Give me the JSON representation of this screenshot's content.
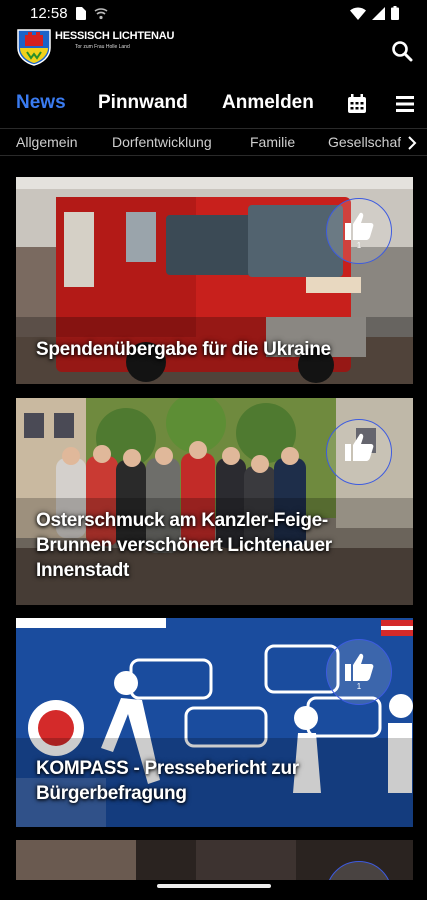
{
  "status": {
    "time": "12:58"
  },
  "header": {
    "title": "HESSISCH LICHTENAU",
    "subtitle": "Tor zum Frau Holle Land"
  },
  "nav": {
    "news": "News",
    "pinnwand": "Pinnwand",
    "anmelden": "Anmelden"
  },
  "categories": [
    "Allgemein",
    "Dorfentwicklung",
    "Familie",
    "Gesellschaft"
  ],
  "articles": [
    {
      "title": "Spendenübergabe für die Ukraine",
      "likes": "1"
    },
    {
      "title": "Osterschmuck am Kanzler-Feige-Brunnen verschönert Lichtenauer Innenstadt",
      "likes": ""
    },
    {
      "title": "KOMPASS - Pressebericht zur Bürgerbefragung",
      "likes": "1"
    }
  ],
  "colors": {
    "accent": "#3a7bf0",
    "like_border": "#3d5be0",
    "background": "#000000"
  }
}
